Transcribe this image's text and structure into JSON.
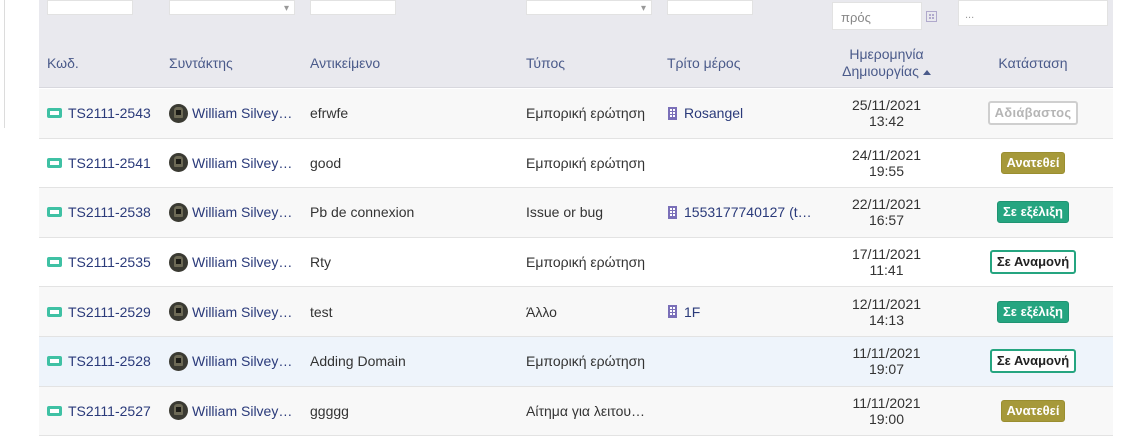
{
  "filters": {
    "date_placeholder": "πρός",
    "status_placeholder": "..."
  },
  "columns": {
    "ref": "Κωδ.",
    "author": "Συντάκτης",
    "subject": "Αντικείμενο",
    "type": "Τύπος",
    "third_party": "Τρίτο μέρος",
    "date_line1": "Ημερομηνία",
    "date_line2": "Δημιουργίας",
    "status": "Κατάσταση"
  },
  "colors": {
    "header_bg": "#e9e9ee",
    "link": "#2a3a7a",
    "ticket_icon": "#3fc1a4",
    "status_assigned": "#a6993a",
    "status_in_progress": "#25a580"
  },
  "rows": [
    {
      "ref": "TS2111-2543",
      "author": "William Silvey…",
      "subject": "efrwfe",
      "type": "Εμπορική ερώτηση",
      "third_party": "Rosangel",
      "date": "25/11/2021",
      "time": "13:42",
      "status": "Αδιάβαστος",
      "status_kind": "unread"
    },
    {
      "ref": "TS2111-2541",
      "author": "William Silvey…",
      "subject": "good",
      "type": "Εμπορική ερώτηση",
      "third_party": "",
      "date": "24/11/2021",
      "time": "19:55",
      "status": "Ανατεθεί",
      "status_kind": "assigned"
    },
    {
      "ref": "TS2111-2538",
      "author": "William Silvey…",
      "subject": "Pb de connexion",
      "type": "Issue or bug",
      "third_party": "1553177740127 (t…",
      "date": "22/11/2021",
      "time": "16:57",
      "status": "Σε εξέλιξη",
      "status_kind": "progress"
    },
    {
      "ref": "TS2111-2535",
      "author": "William Silvey…",
      "subject": "Rty",
      "type": "Εμπορική ερώτηση",
      "third_party": "",
      "date": "17/11/2021",
      "time": "11:41",
      "status": "Σε Αναμονή",
      "status_kind": "waiting"
    },
    {
      "ref": "TS2111-2529",
      "author": "William Silvey…",
      "subject": "test",
      "type": "Άλλο",
      "third_party": "1F",
      "date": "12/11/2021",
      "time": "14:13",
      "status": "Σε εξέλιξη",
      "status_kind": "progress"
    },
    {
      "ref": "TS2111-2528",
      "author": "William Silvey…",
      "subject": "Adding Domain",
      "type": "Εμπορική ερώτηση",
      "third_party": "",
      "date": "11/11/2021",
      "time": "19:07",
      "status": "Σε Αναμονή",
      "status_kind": "waiting"
    },
    {
      "ref": "TS2111-2527",
      "author": "William Silvey…",
      "subject": "ggggg",
      "type": "Αίτημα για λειτου…",
      "third_party": "",
      "date": "11/11/2021",
      "time": "19:00",
      "status": "Ανατεθεί",
      "status_kind": "assigned"
    }
  ]
}
